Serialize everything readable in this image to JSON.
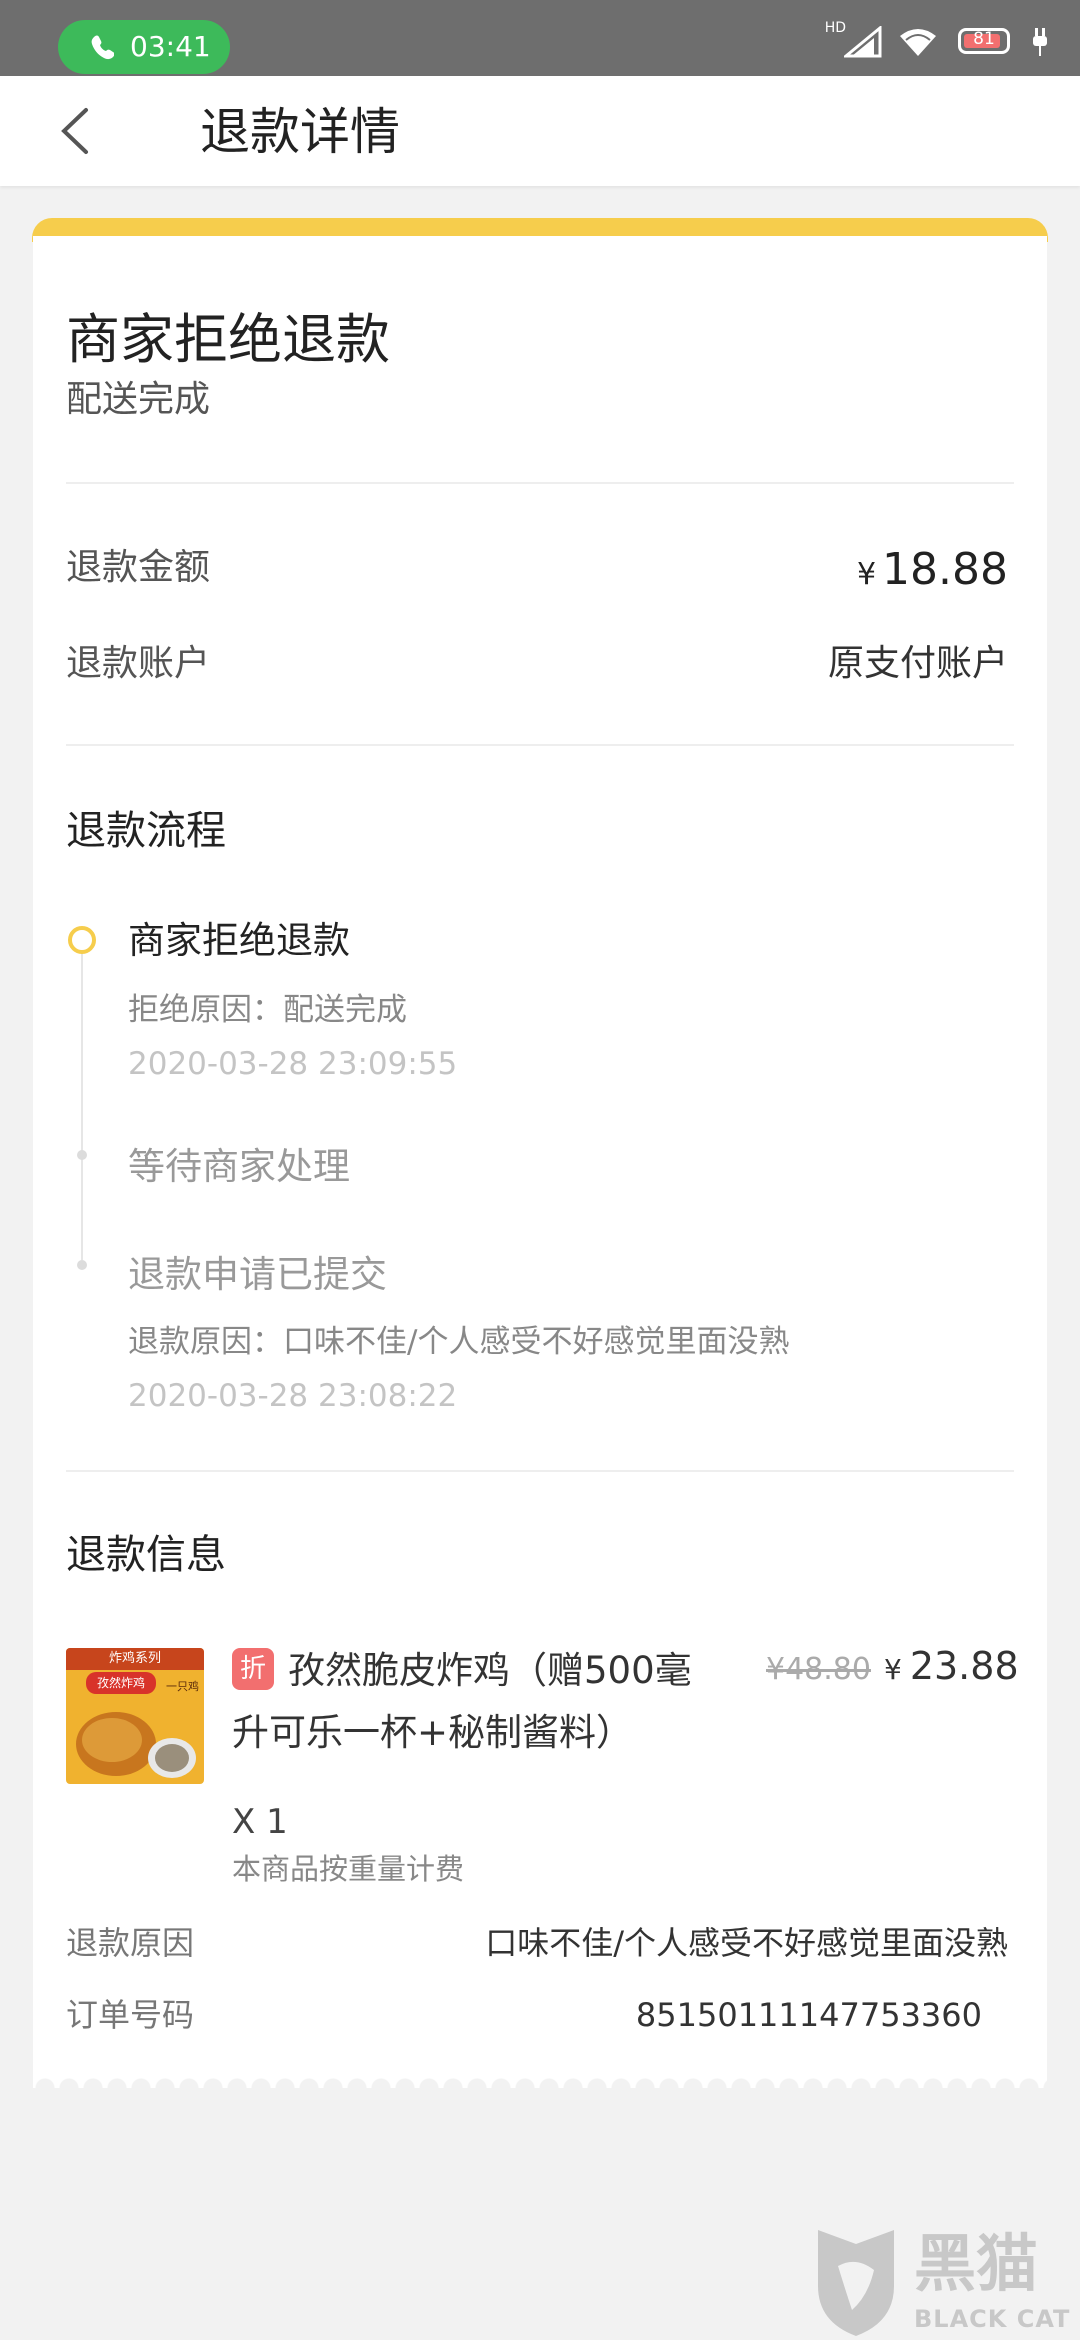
{
  "status_bar": {
    "time": "03:41",
    "network_label": "HD",
    "battery": "81"
  },
  "header": {
    "title": "退款详情"
  },
  "refund_status": {
    "title": "商家拒绝退款",
    "subtitle": "配送完成"
  },
  "summary": {
    "amount_label": "退款金额",
    "currency": "¥",
    "amount": "18.88",
    "account_label": "退款账户",
    "account_value": "原支付账户"
  },
  "process": {
    "title": "退款流程",
    "steps": [
      {
        "title": "商家拒绝退款",
        "reason": "拒绝原因：配送完成",
        "time": "2020-03-28 23:09:55"
      },
      {
        "title": "等待商家处理"
      },
      {
        "title": "退款申请已提交",
        "reason": "退款原因：口味不佳/个人感受不好感觉里面没熟",
        "time": "2020-03-28 23:08:22"
      }
    ]
  },
  "info": {
    "title": "退款信息",
    "product": {
      "badge": "折",
      "name": "孜然脆皮炸鸡（赠500毫升可乐一杯+秘制酱料）",
      "original_price": "¥48.80",
      "currency": "¥",
      "price": "23.88",
      "quantity": "X 1",
      "note": "本商品按重量计费",
      "thumb_text_top": "炸鸡系列",
      "thumb_text_main": "孜然炸鸡",
      "thumb_text_side": "一只鸡"
    },
    "reason_label": "退款原因",
    "reason_value": "口味不佳/个人感受不好感觉里面没熟",
    "order_label": "订单号码",
    "order_value": "85150111147753360"
  },
  "watermark": {
    "name_cn": "黑猫",
    "name_en": "BLACK CAT"
  },
  "colors": {
    "accent_yellow": "#f6cd4c",
    "call_green": "#3dba5a",
    "badge_red": "#f26f6f",
    "status_bar": "#6e6e6e"
  }
}
